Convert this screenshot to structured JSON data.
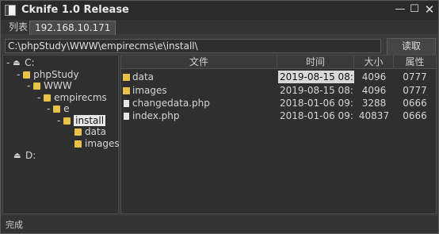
{
  "window": {
    "title": "Cknife 1.0 Release",
    "controls": {
      "minimize": "—",
      "maximize": "☐",
      "close": "✕"
    }
  },
  "tabs": [
    {
      "label": "列表"
    },
    {
      "label": "192.168.10.171"
    }
  ],
  "pathbar": {
    "path_value": "C:\\phpStudy\\WWW\\empirecms\\e\\install\\",
    "read_label": "读取"
  },
  "tree": {
    "nodes": [
      {
        "label": "C:",
        "icon": "drive-icon"
      },
      {
        "label": "phpStudy",
        "icon": "folder-icon"
      },
      {
        "label": "WWW",
        "icon": "folder-icon"
      },
      {
        "label": "empirecms",
        "icon": "folder-icon"
      },
      {
        "label": "e",
        "icon": "folder-icon"
      },
      {
        "label": "install",
        "icon": "folder-icon",
        "selected": true
      },
      {
        "label": "data",
        "icon": "folder-icon"
      },
      {
        "label": "images",
        "icon": "folder-icon"
      },
      {
        "label": "D:",
        "icon": "drive-icon"
      }
    ]
  },
  "filelist": {
    "headers": {
      "name": "文件",
      "time": "时间",
      "size": "大小",
      "attr": "属性"
    },
    "rows": [
      {
        "name": "data",
        "type": "folder",
        "time": "2019-08-15 08:...",
        "size": "4096",
        "attr": "0777"
      },
      {
        "name": "images",
        "type": "folder",
        "time": "2019-08-15 08:...",
        "size": "4096",
        "attr": "0777"
      },
      {
        "name": "changedata.php",
        "type": "file",
        "time": "2018-01-06 09:...",
        "size": "3288",
        "attr": "0666"
      },
      {
        "name": "index.php",
        "type": "file",
        "time": "2018-01-06 09:...",
        "size": "40837",
        "attr": "0666"
      }
    ]
  },
  "status": {
    "text": "完成"
  },
  "colors": {
    "folder": "#e8c248",
    "background": "#2f2f2f",
    "selection": "#e8e8e8"
  }
}
